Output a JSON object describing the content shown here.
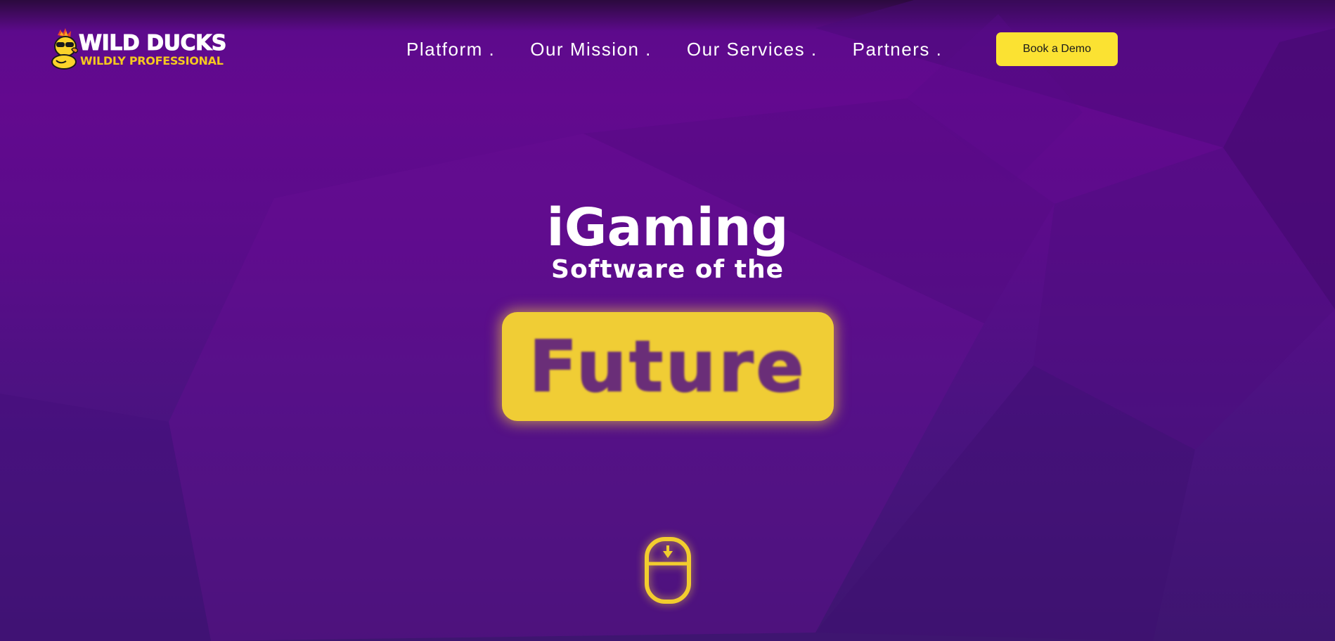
{
  "colors": {
    "accent_yellow": "#fbe232",
    "purple_bg": "#5d0a8c",
    "future_text": "#6a2e78"
  },
  "logo": {
    "mark_icon": "duck-mascot-icon",
    "title": "WILD DUCKS",
    "tagline": "WILDLY PROFESSIONAL"
  },
  "nav": {
    "items": [
      {
        "label": "Platform ."
      },
      {
        "label": "Our Mission ."
      },
      {
        "label": "Our Services ."
      },
      {
        "label": "Partners ."
      }
    ]
  },
  "header": {
    "cta_label": "Book a Demo"
  },
  "hero": {
    "line1": "iGaming",
    "line2": "Software of the",
    "highlight": "Future",
    "scroll_icon": "mouse-scroll-icon"
  }
}
